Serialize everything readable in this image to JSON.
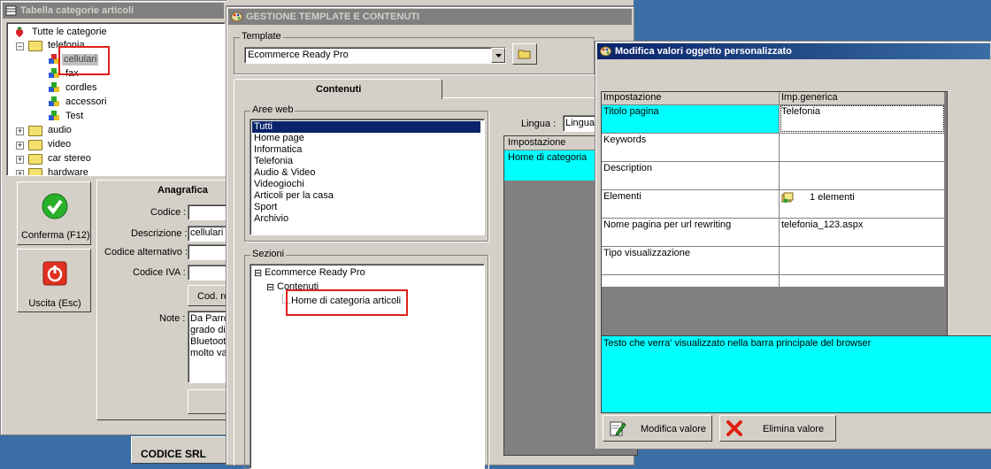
{
  "win_categories": {
    "title": "Tabella categorie articoli",
    "tree": {
      "root": "Tutte le categorie",
      "telefonia": "telefonia",
      "children": [
        "cellulari",
        "fax",
        "cordles",
        "accessori",
        "Test"
      ],
      "others": [
        "audio",
        "video",
        "car stereo",
        "hardware"
      ]
    },
    "buttons": {
      "confirm": "Conferma (F12)",
      "exit": "Uscita (Esc)"
    },
    "anagrafica": {
      "title": "Anagrafica",
      "codice_label": "Codice :",
      "codice_value": "",
      "descrizione_label": "Descrizione :",
      "descrizione_value": "cellulari",
      "codice_alt_label": "Codice alternativo :",
      "codice_iva_label": "Codice IVA :",
      "cod_button": "Cod. re",
      "note_label": "Note :",
      "note_lines": [
        "Da Parro",
        "grado di",
        "Bluetoot",
        "molto va"
      ]
    },
    "company": "CODICE SRL"
  },
  "win_templates": {
    "title": "GESTIONE TEMPLATE E CONTENUTI",
    "template_label": "Template",
    "template_value": "Ecommerce Ready Pro",
    "tab_contenuti": "Contenuti",
    "aree_web_label": "Aree web",
    "aree_web": [
      "Tutti",
      "Home page",
      "Informatica",
      "Telefonia",
      "Audio & Video",
      "Videogiochi",
      "Articoli per la casa",
      "Sport",
      "Archivio"
    ],
    "sezioni_label": "Sezioni",
    "sezioni": {
      "root": "Ecommerce Ready Pro",
      "child": "Contenuti",
      "leaf": "Home di categoria articoli"
    },
    "lingua_label": "Lingua :",
    "lingua_value": "Lingua",
    "grid_header": "Impostazione",
    "grid_row": "Home di categoria"
  },
  "win_modify": {
    "title": "Modifica valori oggetto personalizzato",
    "col_setting": "Impostazione",
    "col_value": "Imp.generica",
    "rows": [
      {
        "setting": "Titolo pagina",
        "value": "Telefonia"
      },
      {
        "setting": "Keywords",
        "value": ""
      },
      {
        "setting": "Description",
        "value": ""
      },
      {
        "setting": "Elementi",
        "value": "1 elementi"
      },
      {
        "setting": "Nome pagina per url rewriting",
        "value": "telefonia_123.aspx"
      },
      {
        "setting": "Tipo visualizzazione",
        "value": ""
      }
    ],
    "description": "Testo che verra' visualizzato nella barra principale del browser",
    "btn_modify": "Modifica valore",
    "btn_delete": "Elimina valore"
  },
  "colors": {
    "highlight_cyan": "#00ffff",
    "selection_blue": "#0a246a",
    "annotation_red": "#e0201a"
  }
}
